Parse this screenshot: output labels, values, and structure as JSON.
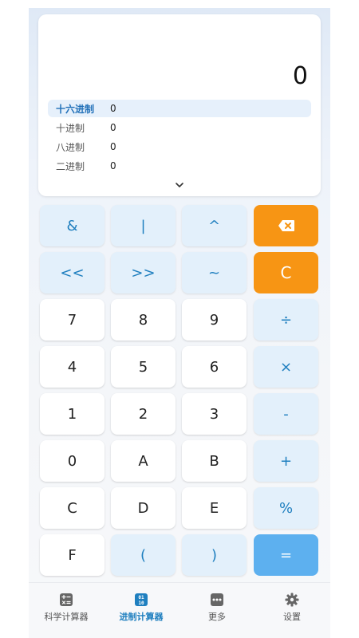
{
  "display": {
    "main_value": "0",
    "bases": [
      {
        "label": "十六进制",
        "value": "0"
      },
      {
        "label": "十进制",
        "value": "0"
      },
      {
        "label": "八进制",
        "value": "0"
      },
      {
        "label": "二进制",
        "value": "0"
      }
    ]
  },
  "keys": {
    "and": "&",
    "or": "|",
    "xor": "^",
    "lshift": "<<",
    "rshift": ">>",
    "not": "~",
    "clear": "C",
    "k7": "7",
    "k8": "8",
    "k9": "9",
    "div": "÷",
    "k4": "4",
    "k5": "5",
    "k6": "6",
    "mul": "×",
    "k1": "1",
    "k2": "2",
    "k3": "3",
    "sub": "-",
    "k0": "0",
    "kA": "A",
    "kB": "B",
    "add": "+",
    "kC": "C",
    "kD": "D",
    "kE": "E",
    "mod": "%",
    "kF": "F",
    "lparen": "(",
    "rparen": ")",
    "equals": "="
  },
  "nav": {
    "items": [
      {
        "label": "科学计算器",
        "icon": "calculator-icon"
      },
      {
        "label": "进制计算器",
        "icon": "binary-icon"
      },
      {
        "label": "更多",
        "icon": "more-icon"
      },
      {
        "label": "设置",
        "icon": "gear-icon"
      }
    ],
    "active_index": 1
  },
  "colors": {
    "accent": "#1f7fbf",
    "orange": "#f79514",
    "equals": "#5db0ef",
    "op_bg": "#e3f0fb"
  }
}
